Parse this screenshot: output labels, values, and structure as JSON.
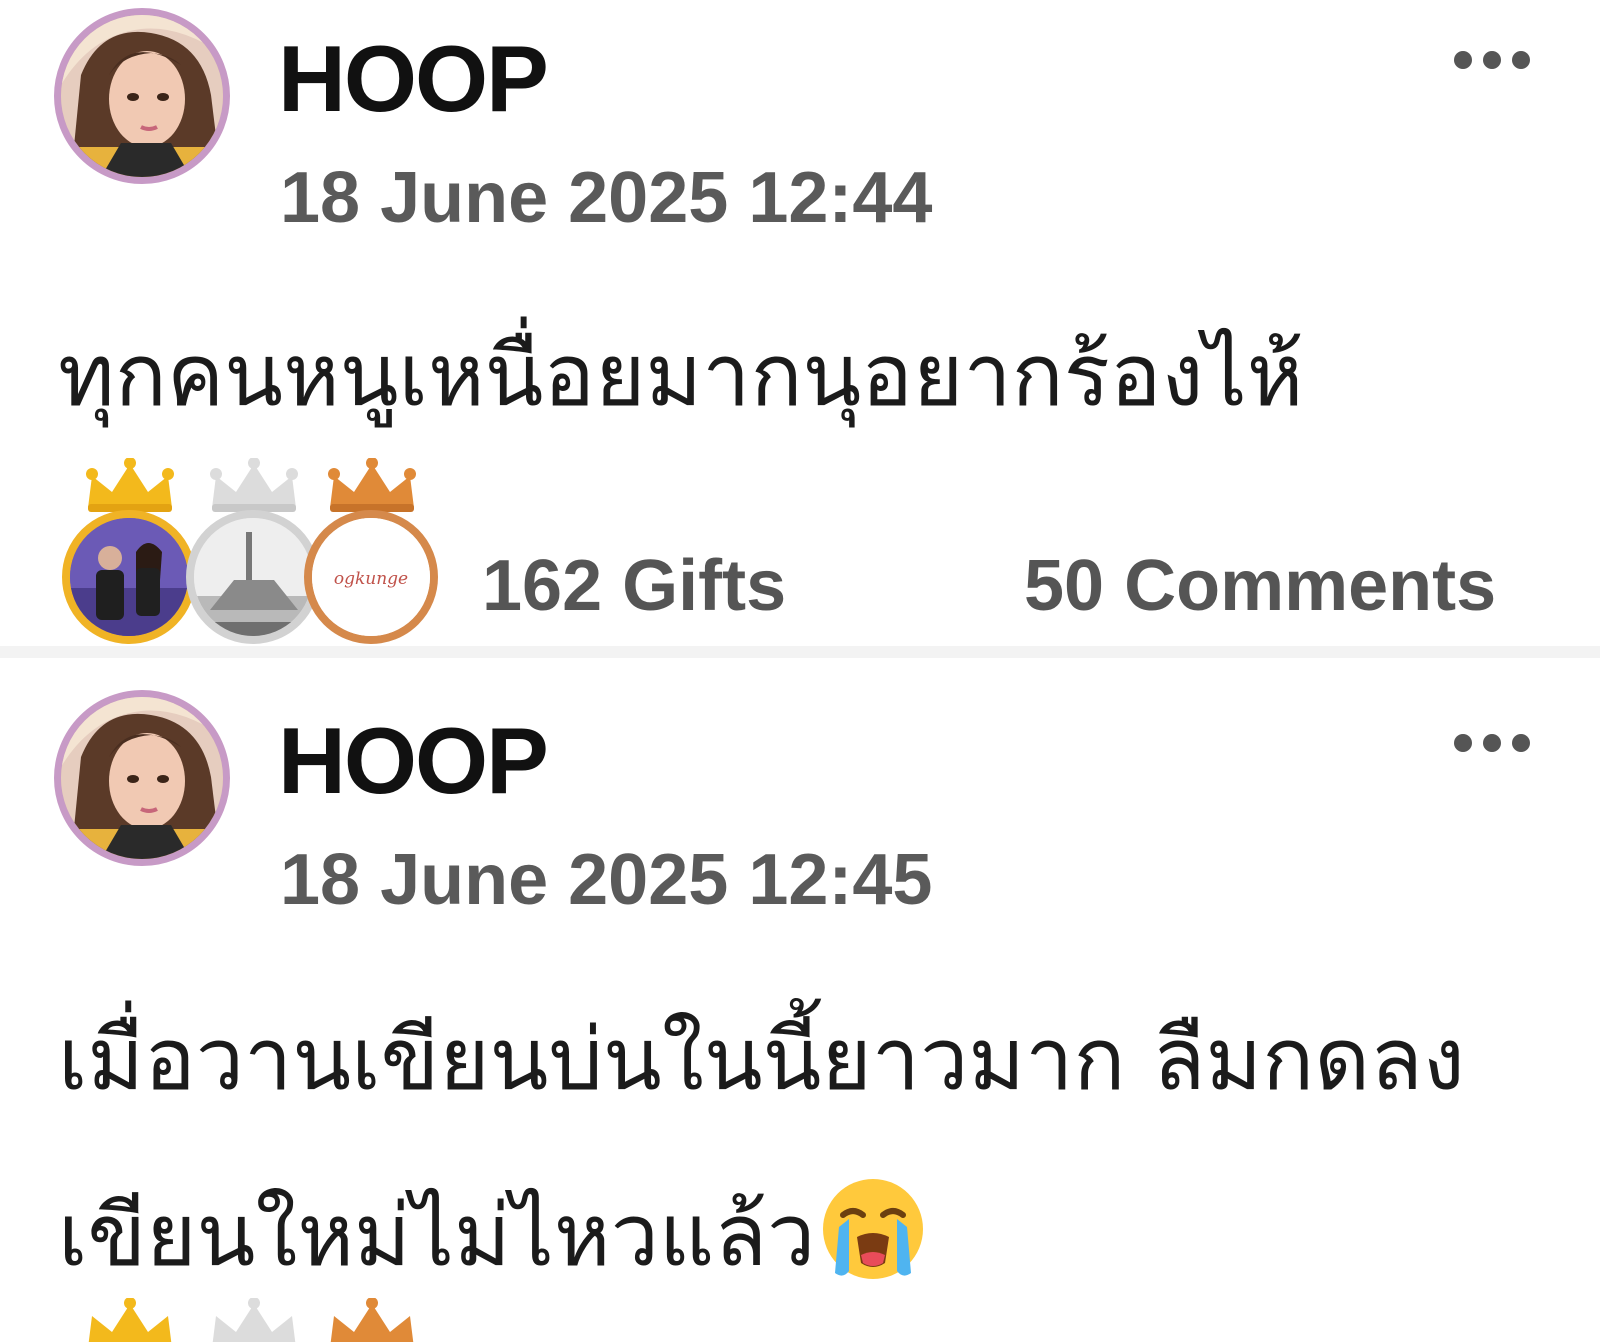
{
  "posts": [
    {
      "author": "HOOP",
      "timestamp": "18 June 2025 12:44",
      "text_lines": [
        "ทุกคนหนูเหนื่อยมากนุอยากร้องไห้"
      ],
      "gifts_label": "162 Gifts",
      "comments_label": "50 Comments",
      "more_icon": "more-horizontal-icon",
      "top_gifters": [
        {
          "crown": "gold",
          "ring_color": "#f0b325",
          "badge_text": ""
        },
        {
          "crown": "silver",
          "ring_color": "#d2d2d2",
          "badge_text": ""
        },
        {
          "crown": "bronze",
          "ring_color": "#d5894b",
          "badge_text": "ogkunge"
        }
      ]
    },
    {
      "author": "HOOP",
      "timestamp": "18 June 2025 12:45",
      "text_lines": [
        "เมื่อวานเขียนบ่นในนี้ยาวมาก ลืมกดลง",
        "เขียนใหม่ไม่ไหวแล้ว"
      ],
      "text_emoji": "loudly-crying-face",
      "more_icon": "more-horizontal-icon"
    }
  ],
  "colors": {
    "author": "#111111",
    "timestamp": "#5a5a5a",
    "counts": "#555555",
    "avatar_ring": "#c79ac6",
    "crown_gold": "#f3b91c",
    "crown_silver": "#d9d9d9",
    "crown_bronze": "#e08a38"
  }
}
